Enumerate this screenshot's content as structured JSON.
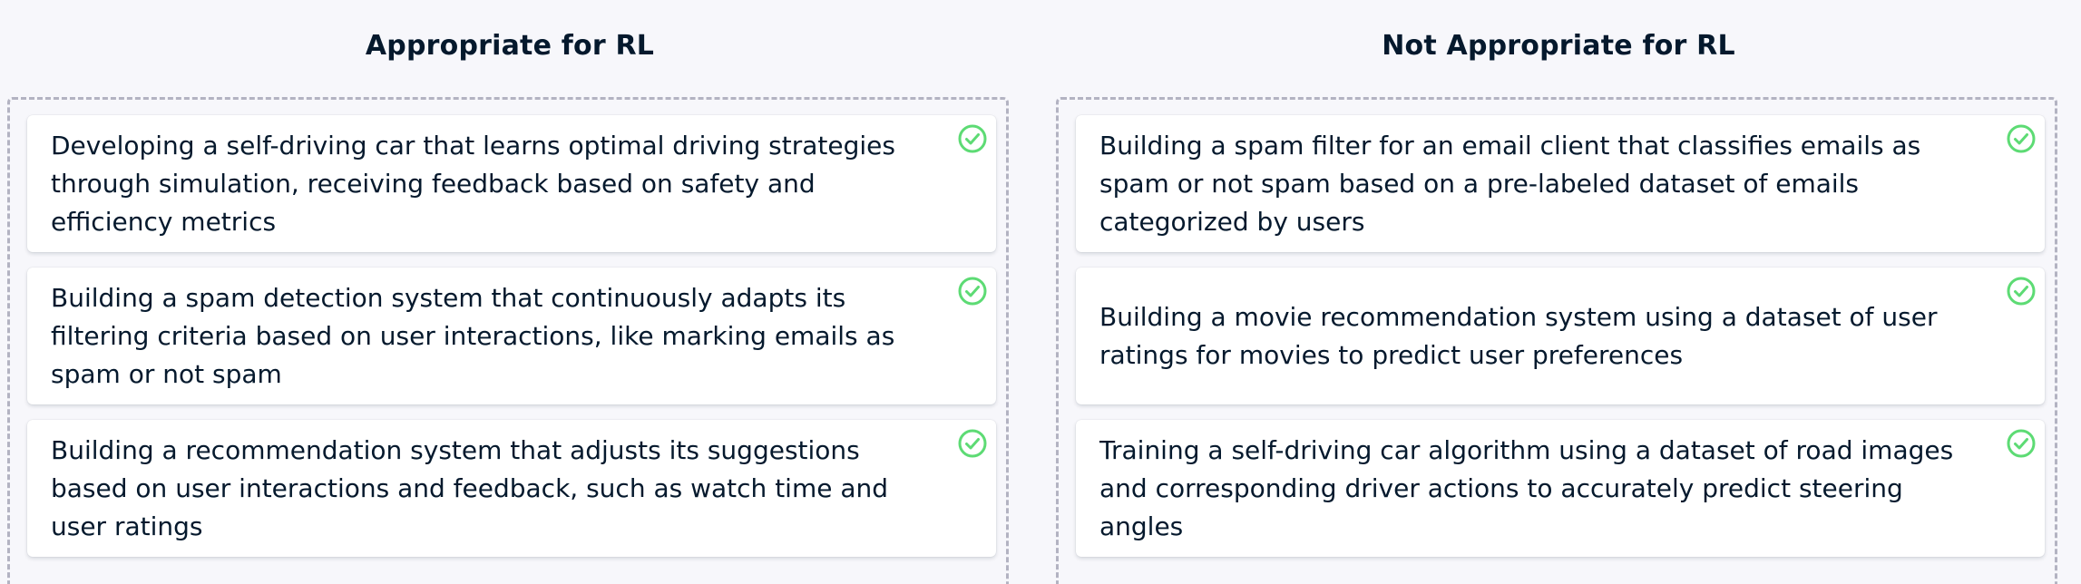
{
  "columns": [
    {
      "title": "Appropriate for RL",
      "cards": [
        {
          "text": "Developing a self-driving car that learns optimal driving strategies through simulation, receiving feedback based on safety and efficiency metrics",
          "status": "correct"
        },
        {
          "text": "Building a spam detection system that continuously adapts its filtering criteria based on user interactions, like marking emails as spam or not spam",
          "status": "correct"
        },
        {
          "text": "Building a recommendation system that adjusts its suggestions based on user interactions and feedback, such as watch time and user ratings",
          "status": "correct"
        }
      ]
    },
    {
      "title": "Not Appropriate for RL",
      "cards": [
        {
          "text": "Building a spam filter for an email client that classifies emails as spam or not spam based on a pre-labeled dataset of emails categorized by users",
          "status": "correct"
        },
        {
          "text": "Building a movie recommendation system using a dataset of user ratings for movies to predict user preferences",
          "status": "correct"
        },
        {
          "text": "Training a self-driving car algorithm using a dataset of road images and corresponding driver actions to accurately predict steering angles",
          "status": "correct"
        }
      ]
    }
  ],
  "colors": {
    "check": "#5ddb74",
    "text": "#05192d",
    "background": "#f7f7fb",
    "dashed_border": "#b3b3c2"
  },
  "icons": {
    "card_status": "check-circle-icon"
  }
}
